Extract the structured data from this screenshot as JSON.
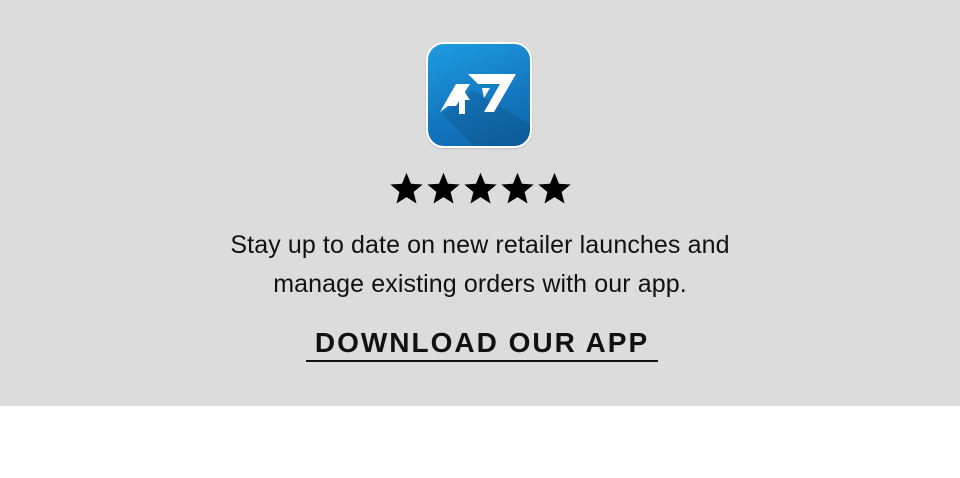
{
  "promo": {
    "background_color": "#dcdcdc",
    "app_icon": {
      "icon_name": "app-logo-icon",
      "colors": {
        "gradient_start": "#1f9ce0",
        "gradient_end": "#0f64a8",
        "glyph": "#ffffff"
      }
    },
    "rating": {
      "stars": 5,
      "max_stars": 5,
      "icon_name": "star-icon",
      "color": "#000000"
    },
    "description": {
      "line1": "Stay up to date on new retailer launches and",
      "line2": "manage existing orders with our app."
    },
    "cta": {
      "label": "DOWNLOAD OUR APP"
    }
  }
}
